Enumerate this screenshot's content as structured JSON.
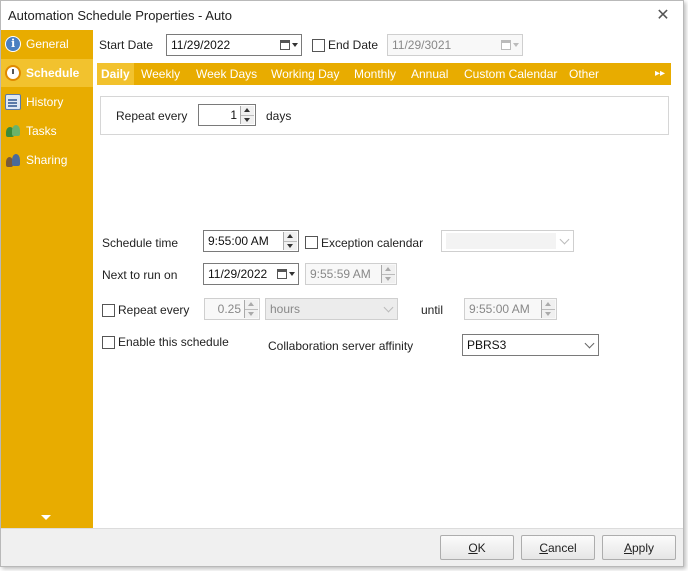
{
  "window": {
    "title": "Automation Schedule Properties - Auto",
    "close_label": "✕"
  },
  "sidebar": {
    "items": [
      {
        "label": "General",
        "icon": "info-icon"
      },
      {
        "label": "Schedule",
        "icon": "clock-icon"
      },
      {
        "label": "History",
        "icon": "history-icon"
      },
      {
        "label": "Tasks",
        "icon": "tasks-icon"
      },
      {
        "label": "Sharing",
        "icon": "sharing-icon"
      }
    ],
    "active": "Schedule",
    "colors": {
      "background": "#e8ac00",
      "active": "#f2c22e"
    }
  },
  "dates": {
    "start_label": "Start Date",
    "start_value": "11/29/2022",
    "end_label": "End Date",
    "end_value": "11/29/3021",
    "end_checked": false
  },
  "tabs": {
    "items": [
      "Daily",
      "Weekly",
      "Week Days",
      "Working Day",
      "Monthly",
      "Annual",
      "Custom Calendar",
      "Other"
    ],
    "active": "Daily",
    "scroll_label": "▸▸"
  },
  "daily": {
    "repeat_label": "Repeat every",
    "repeat_value": "1",
    "unit_label": "days"
  },
  "schedule": {
    "time_label": "Schedule time",
    "time_value": "9:55:00 AM",
    "exception_label": "Exception calendar",
    "exception_checked": false,
    "exception_value": "",
    "next_label": "Next to run on",
    "next_date": "11/29/2022",
    "next_time": "9:55:59 AM",
    "repeat_label": "Repeat every",
    "repeat_checked": false,
    "repeat_value": "0.25",
    "repeat_unit": "hours",
    "until_label": "until",
    "until_value": "9:55:00 AM",
    "enable_label": "Enable this schedule",
    "enable_checked": false,
    "affinity_label": "Collaboration server affinity",
    "affinity_value": "PBRS3"
  },
  "footer": {
    "ok_accel": "O",
    "ok_rest": "K",
    "cancel_accel": "C",
    "cancel_rest": "ancel",
    "apply_accel": "A",
    "apply_rest": "pply"
  }
}
